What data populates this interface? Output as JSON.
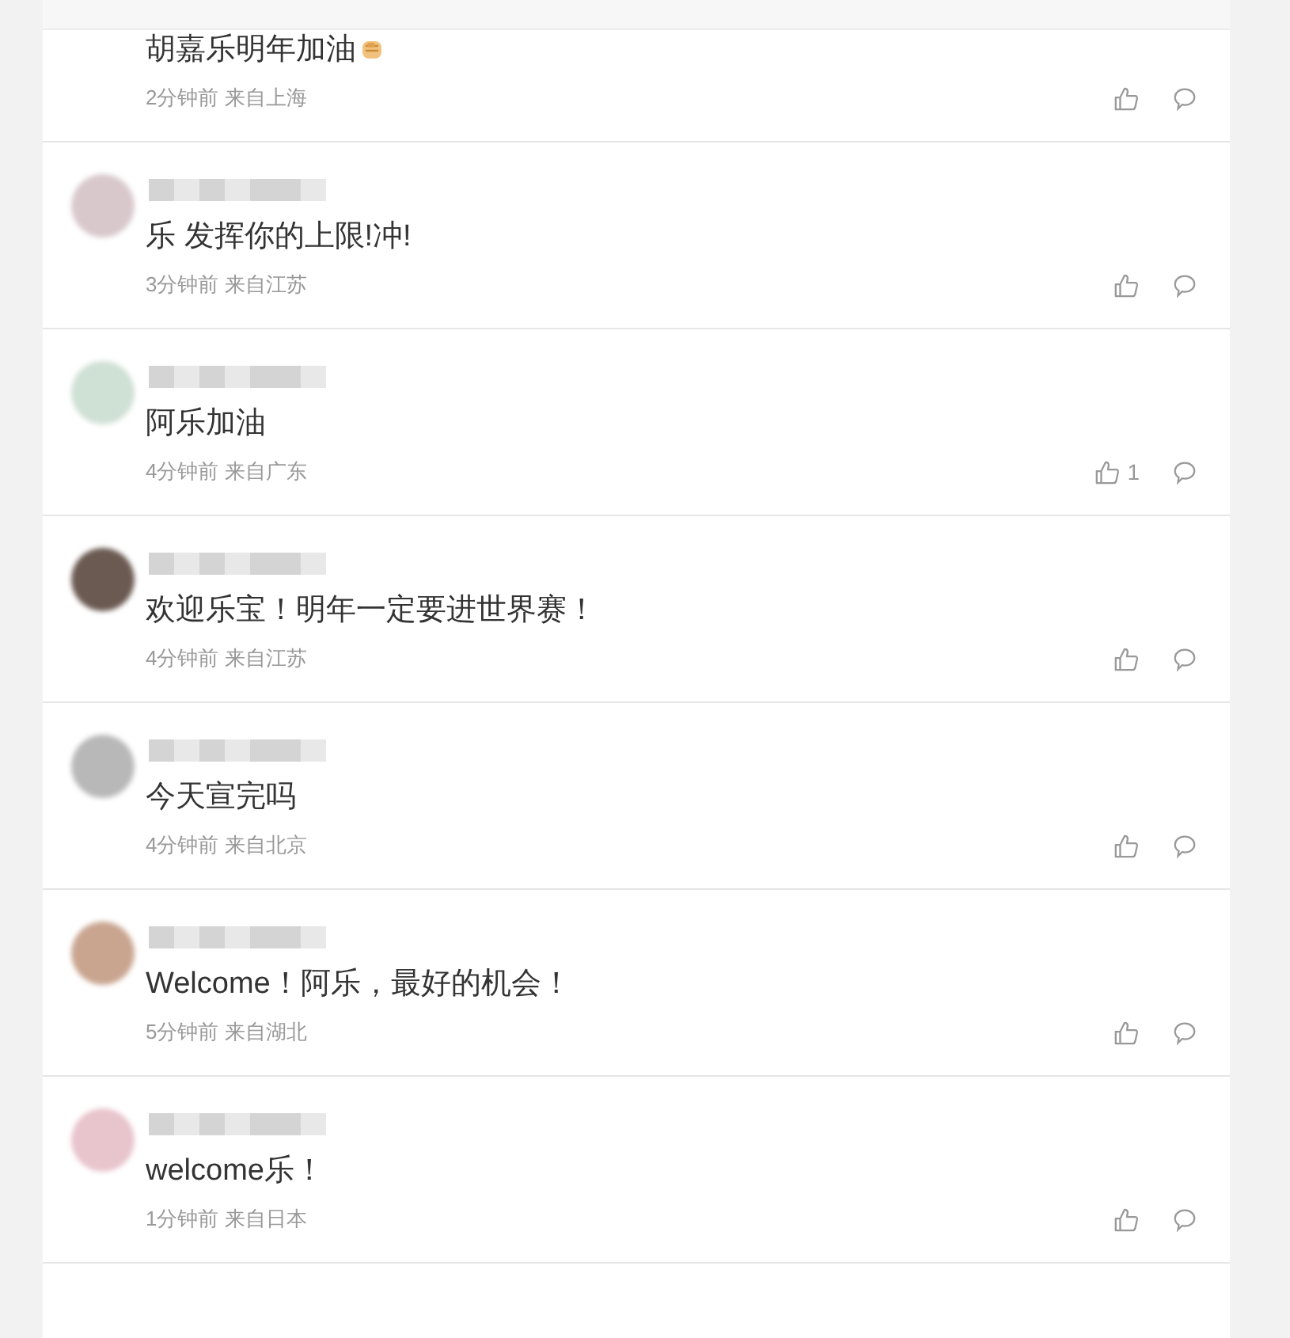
{
  "comments": [
    {
      "text": "胡嘉乐明年加油",
      "has_emoji": true,
      "name_hidden": false,
      "meta": "2分钟前 来自上海"
    },
    {
      "text": "乐 发挥你的上限!冲!",
      "has_emoji": false,
      "name_hidden": true,
      "meta": "3分钟前 来自江苏"
    },
    {
      "text": "阿乐加油",
      "has_emoji": false,
      "name_hidden": true,
      "meta": "4分钟前 来自广东",
      "likes": "1"
    },
    {
      "text": "欢迎乐宝！明年一定要进世界赛！",
      "has_emoji": false,
      "name_hidden": true,
      "meta": "4分钟前 来自江苏"
    },
    {
      "text": "今天宣完吗",
      "has_emoji": false,
      "name_hidden": true,
      "meta": "4分钟前 来自北京"
    },
    {
      "text": "Welcome！阿乐，最好的机会！",
      "has_emoji": false,
      "name_hidden": true,
      "meta": "5分钟前 来自湖北"
    },
    {
      "text": "welcome乐！",
      "has_emoji": false,
      "name_hidden": true,
      "meta": "1分钟前 来自日本"
    }
  ]
}
